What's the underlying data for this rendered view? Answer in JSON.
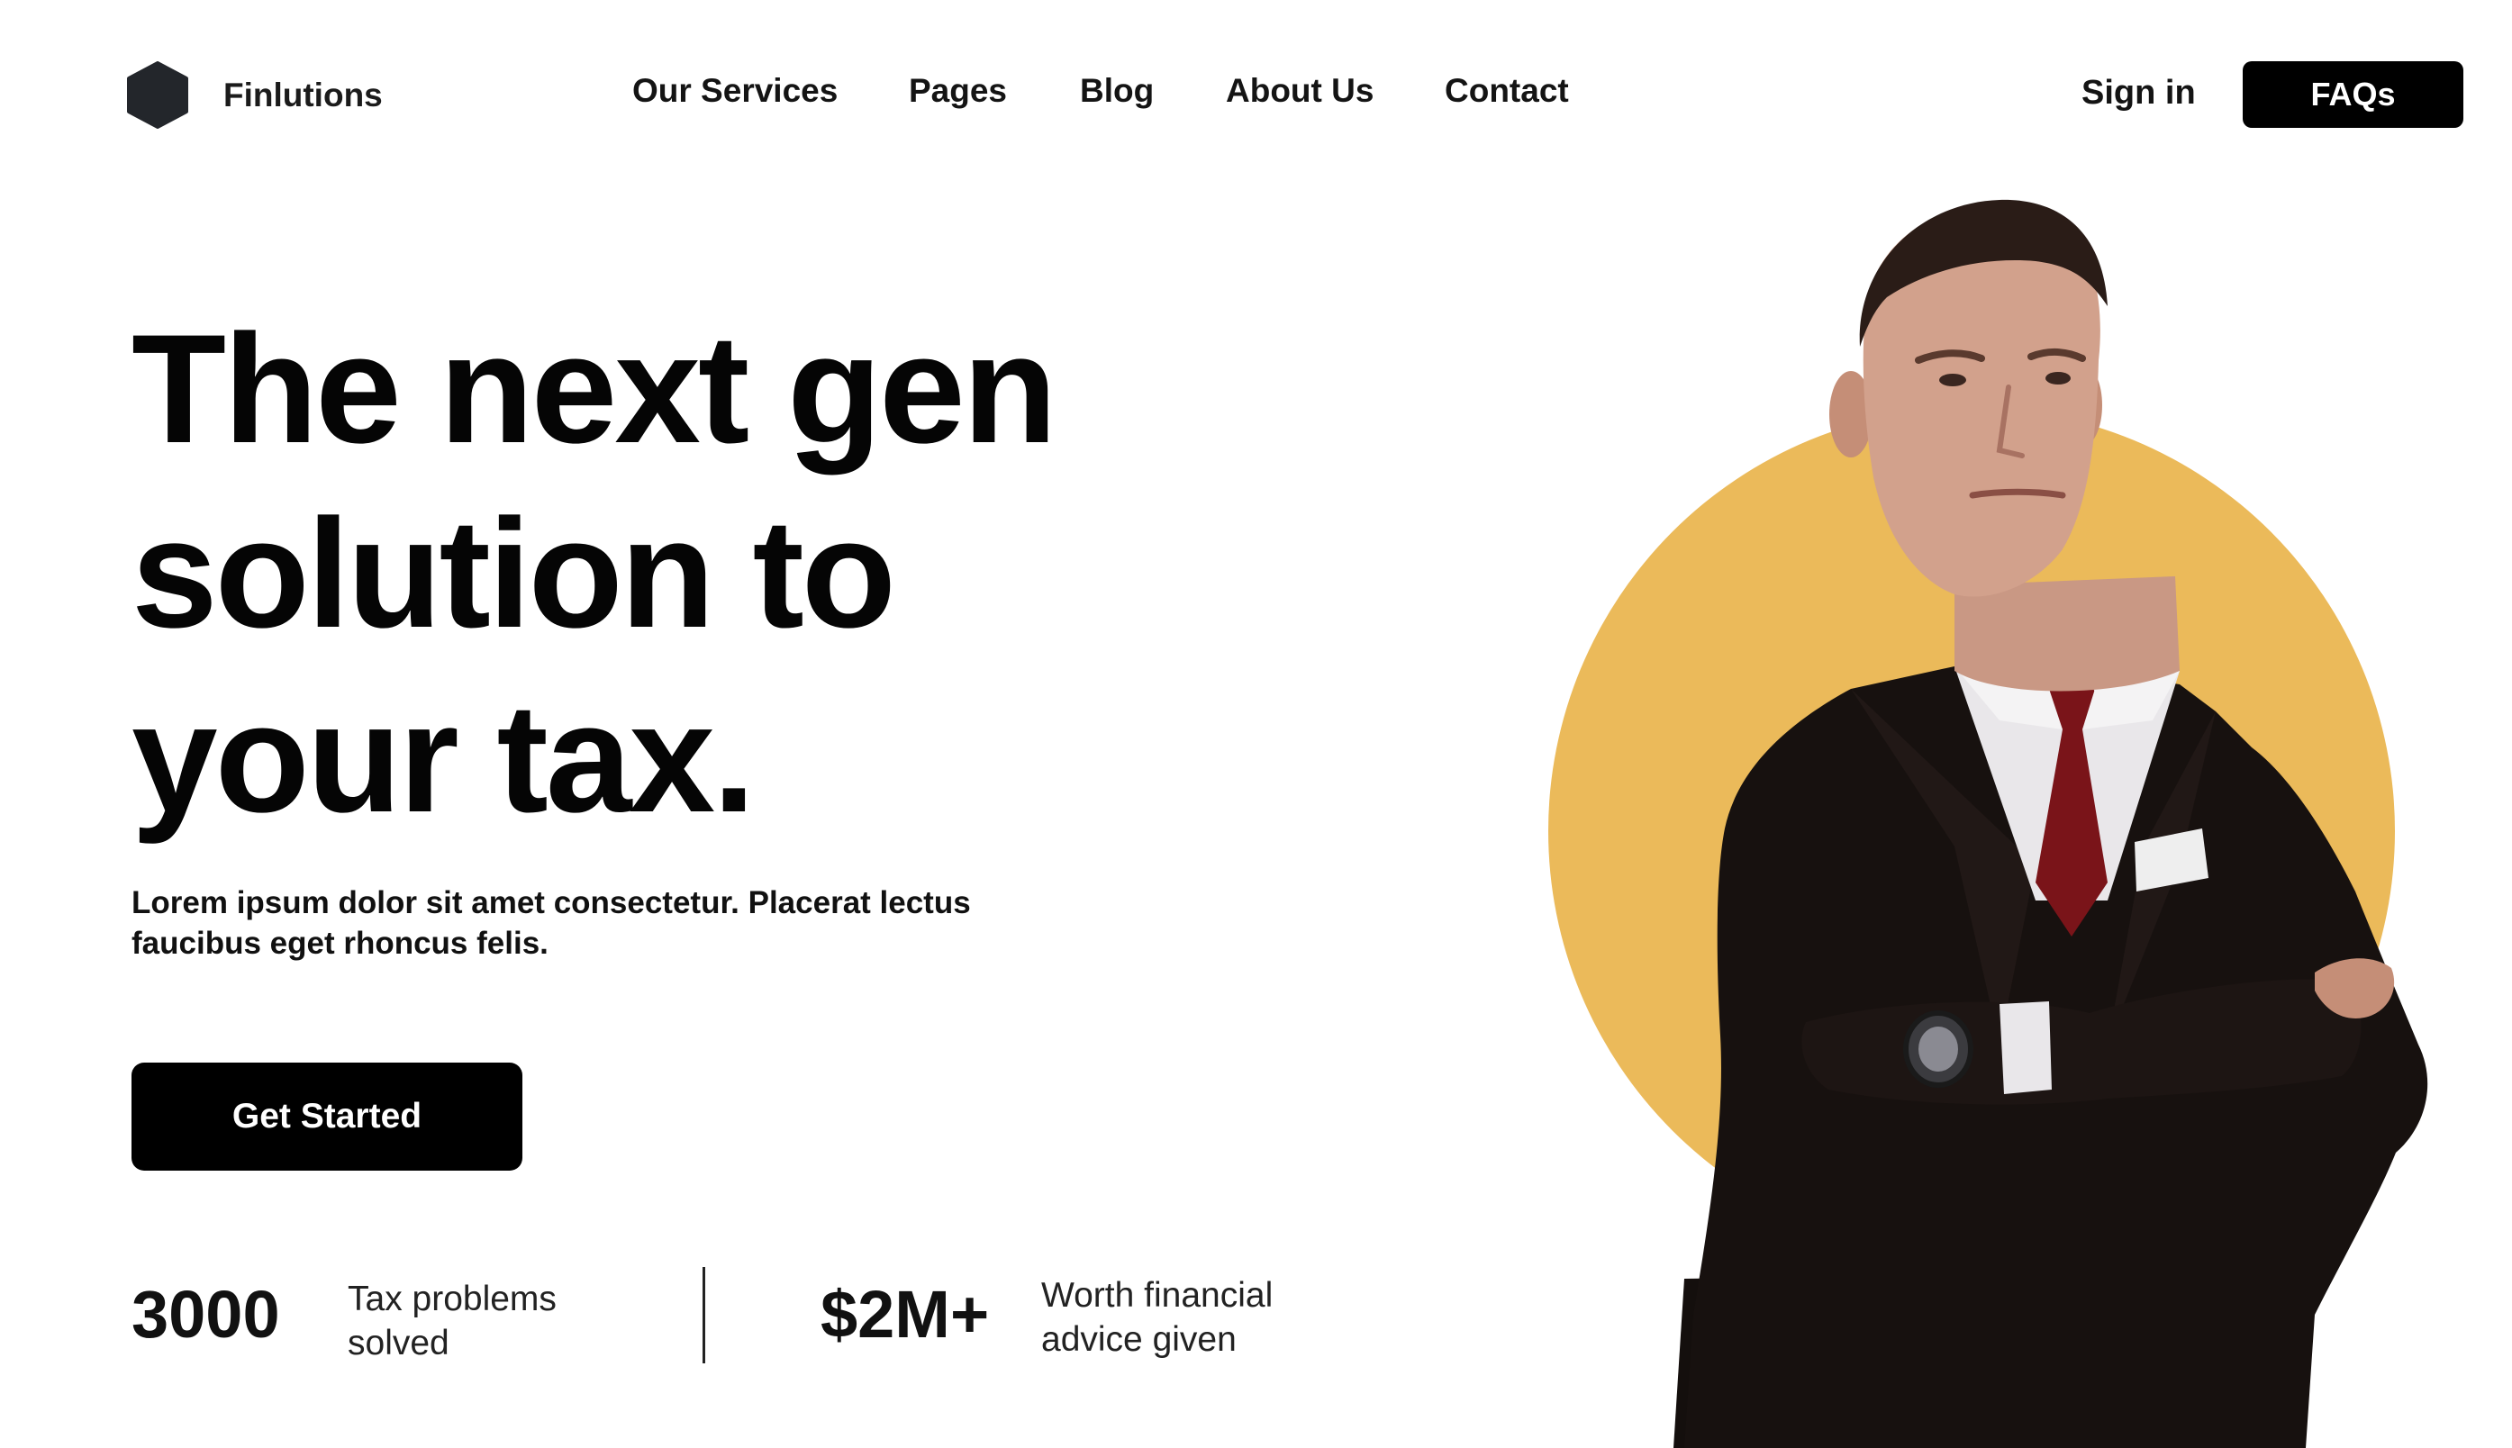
{
  "brand": {
    "name": "Finlutions"
  },
  "nav": {
    "items": [
      {
        "label": "Our Services"
      },
      {
        "label": "Pages"
      },
      {
        "label": "Blog"
      },
      {
        "label": "About Us"
      },
      {
        "label": "Contact"
      }
    ]
  },
  "header": {
    "signin_label": "Sign in",
    "faq_label": "FAQs"
  },
  "hero": {
    "headline_lines": [
      "The next gen",
      "solution to",
      "your tax."
    ],
    "description": "Lorem ipsum dolor sit amet consectetur. Placerat lectus faucibus eget rhoncus felis.",
    "cta_label": "Get Started",
    "stats": [
      {
        "value": "3000",
        "label": "Tax problems solved"
      },
      {
        "value": "$2M+",
        "label": "Worth financial advice given"
      }
    ]
  },
  "colors": {
    "accent": "#EBBA5A",
    "primary": "#000000",
    "text": "#0A0A0A",
    "suit": "#17110F",
    "tie": "#7A1419"
  },
  "icons": {
    "logo": "hexagon-logo-icon"
  }
}
